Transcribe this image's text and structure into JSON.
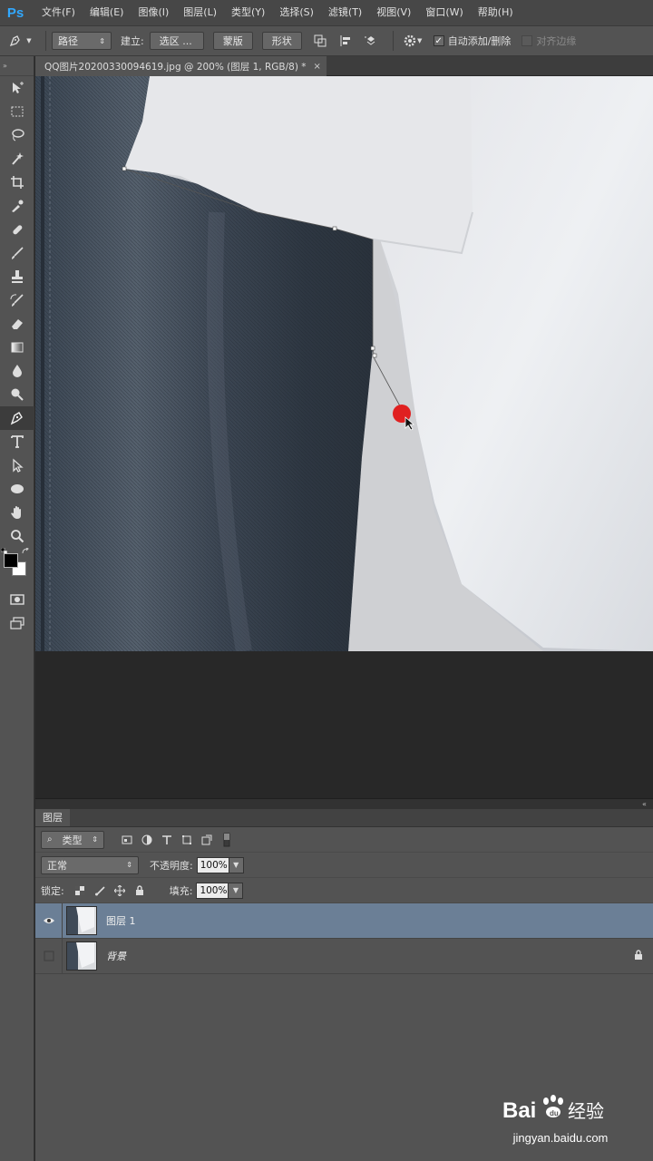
{
  "app": {
    "logo": "Ps"
  },
  "menu": [
    "文件(F)",
    "编辑(E)",
    "图像(I)",
    "图层(L)",
    "类型(Y)",
    "选择(S)",
    "滤镜(T)",
    "视图(V)",
    "窗口(W)",
    "帮助(H)"
  ],
  "options": {
    "mode_select": "路径",
    "make_label": "建立:",
    "selection_btn": "选区 ...",
    "mask_btn": "蒙版",
    "shape_btn": "形状",
    "auto_add_delete": "自动添加/删除",
    "auto_add_delete_checked": true,
    "align_edges": "对齐边缘",
    "align_edges_checked": false
  },
  "tools": [
    "move-icon",
    "marquee-icon",
    "lasso-icon",
    "magic-wand-icon",
    "crop-icon",
    "eyedropper-icon",
    "healing-brush-icon",
    "brush-icon",
    "clone-stamp-icon",
    "history-brush-icon",
    "eraser-icon",
    "gradient-icon",
    "blur-icon",
    "dodge-icon",
    "pen-icon",
    "type-icon",
    "path-select-icon",
    "ellipse-icon",
    "hand-icon",
    "zoom-icon"
  ],
  "active_tool": "pen-icon",
  "document": {
    "tab_title": "QQ图片20200330094619.jpg @ 200% (图层 1, RGB/8) *",
    "close": "×"
  },
  "layers_panel": {
    "tab": "图层",
    "filter_kind": "类型",
    "blend_mode": "正常",
    "opacity_label": "不透明度:",
    "opacity": "100%",
    "lock_label": "锁定:",
    "fill_label": "填充:",
    "fill": "100%",
    "layers": [
      {
        "name": "图层 1",
        "visible": true,
        "selected": true,
        "locked": false
      },
      {
        "name": "背景",
        "visible": false,
        "selected": false,
        "locked": true
      }
    ]
  },
  "watermark": {
    "brand": "Bai",
    "brand2": "经验",
    "url": "jingyan.baidu.com"
  },
  "colors": {
    "menubar": "#474747",
    "panel": "#535353",
    "canvas_bg": "#282828",
    "selected_layer": "#6b7f96",
    "ps_blue": "#31a8ff",
    "pointer_red": "#e02020"
  }
}
